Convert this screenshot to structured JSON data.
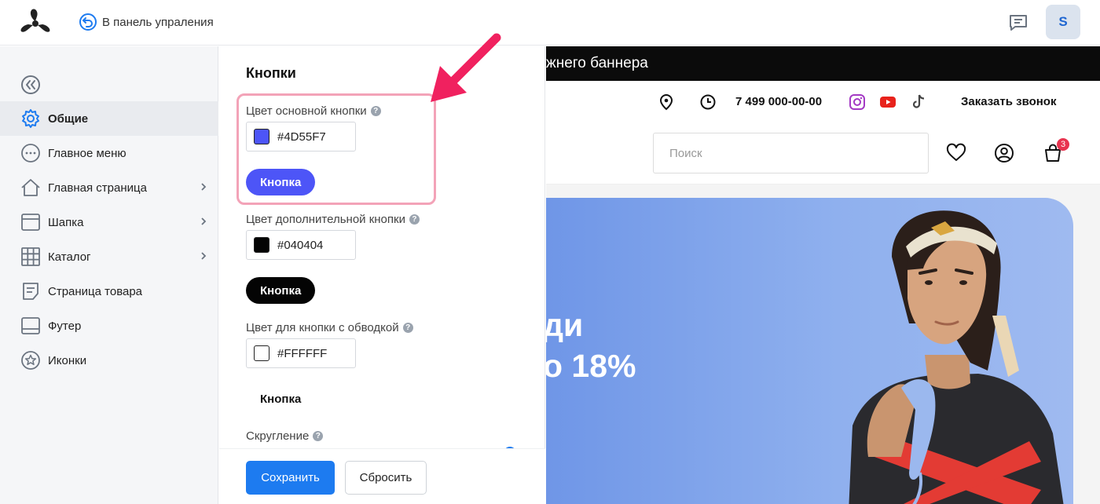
{
  "topbar": {
    "back_label": "В панель упраления",
    "avatar_letter": "S"
  },
  "sidebar": {
    "items": [
      {
        "label": "Общие",
        "icon": "gear-icon",
        "active": true,
        "chevron": false
      },
      {
        "label": "Главное меню",
        "icon": "dots-circle-icon",
        "active": false,
        "chevron": false
      },
      {
        "label": "Главная страница",
        "icon": "home-icon",
        "active": false,
        "chevron": true
      },
      {
        "label": "Шапка",
        "icon": "header-layout-icon",
        "active": false,
        "chevron": true
      },
      {
        "label": "Каталог",
        "icon": "grid-icon",
        "active": false,
        "chevron": true
      },
      {
        "label": "Страница товара",
        "icon": "document-icon",
        "active": false,
        "chevron": false
      },
      {
        "label": "Футер",
        "icon": "footer-layout-icon",
        "active": false,
        "chevron": false
      },
      {
        "label": "Иконки",
        "icon": "star-circle-icon",
        "active": false,
        "chevron": false
      }
    ]
  },
  "panel": {
    "title": "Кнопки",
    "primary": {
      "label": "Цвет основной кнопки",
      "value": "#4D55F7",
      "button_label": "Кнопка",
      "color": "#4D55F7"
    },
    "secondary": {
      "label": "Цвет дополнительной кнопки",
      "value": "#040404",
      "button_label": "Кнопка",
      "color": "#040404"
    },
    "outline": {
      "label": "Цвет для кнопки с обводкой",
      "value": "#FFFFFF",
      "button_label": "Кнопка",
      "color": "#FFFFFF"
    },
    "rounding_label": "Скругление",
    "help_glyph": "?",
    "save_label": "Сохранить",
    "reset_label": "Сбросить"
  },
  "preview": {
    "banner_text": "жнего баннера",
    "phone": "7 499 000-00-00",
    "callback": "Заказать звонок",
    "search_placeholder": "Поиск",
    "cart_count": "3",
    "hero_line1": "ди",
    "hero_line2": "о 18%"
  },
  "colors": {
    "accent": "#1D7BF0",
    "highlight": "#F3A3B8",
    "annotation_arrow": "#F0215F",
    "instagram": "#A43AC4",
    "youtube": "#E8221B"
  }
}
